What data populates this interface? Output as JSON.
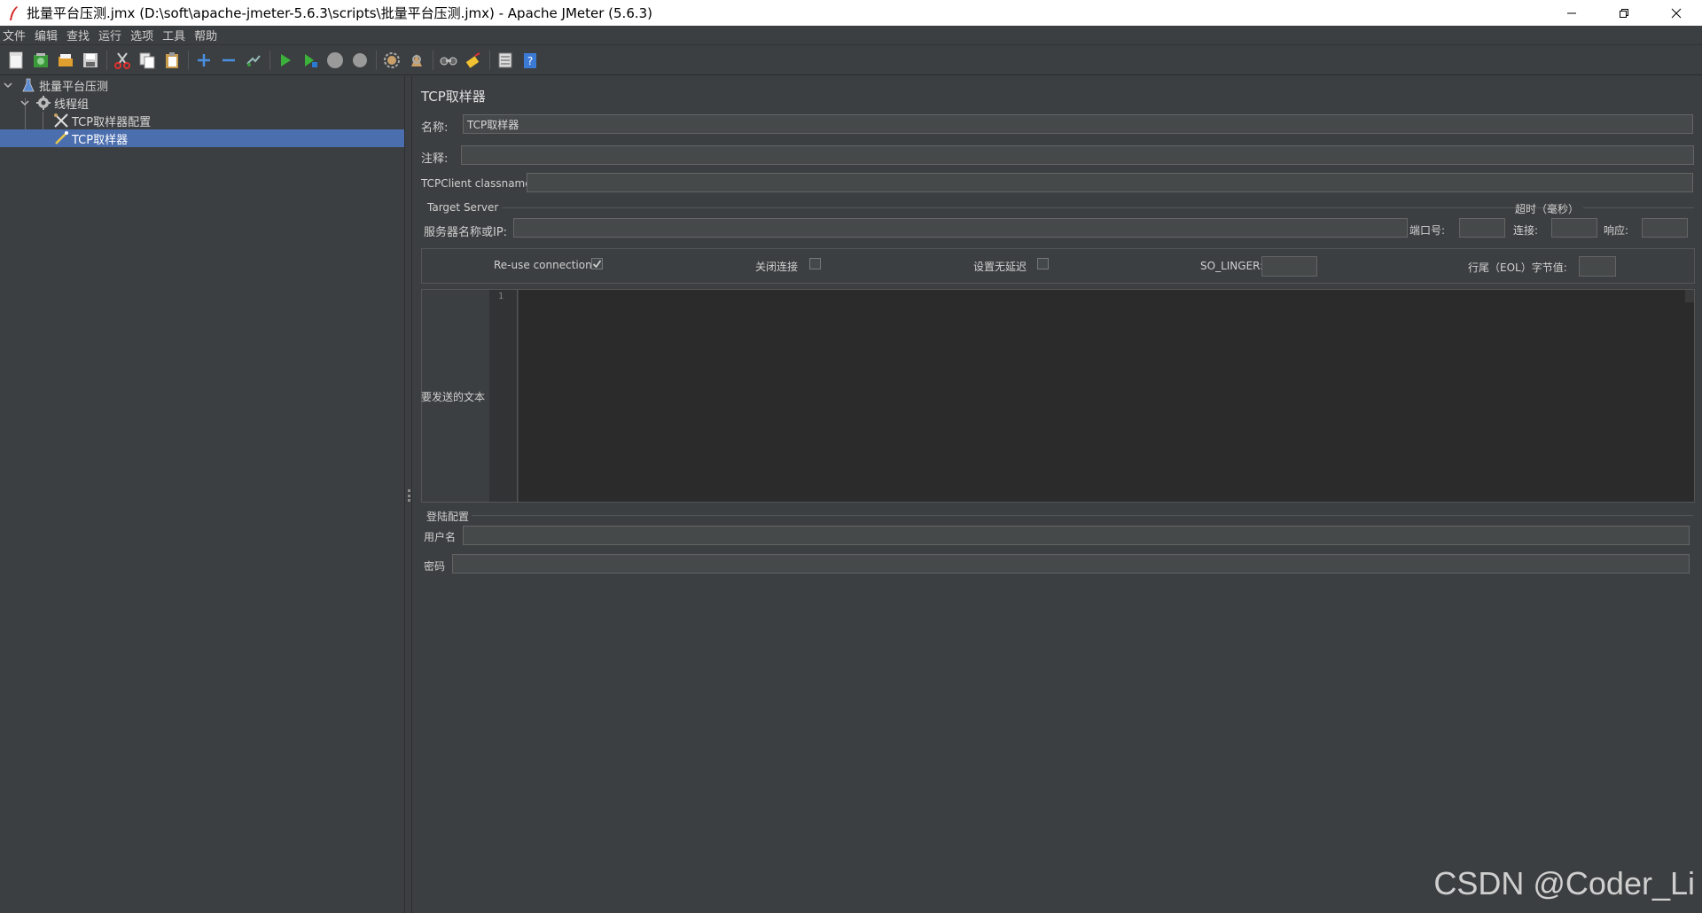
{
  "window": {
    "title": "批量平台压测.jmx (D:\\soft\\apache-jmeter-5.6.3\\scripts\\批量平台压测.jmx) - Apache JMeter (5.6.3)",
    "minimize_icon": "minimize-icon",
    "maximize_icon": "restore-icon",
    "close_icon": "close-icon"
  },
  "menu": [
    "文件",
    "编辑",
    "查找",
    "运行",
    "选项",
    "工具",
    "帮助"
  ],
  "toolbar": [
    "new-icon",
    "templates-icon",
    "open-icon",
    "save-icon",
    "cut-icon",
    "copy-icon",
    "paste-icon",
    "expand-icon",
    "collapse-icon",
    "toggle-icon",
    "start-icon",
    "start-no-pause-icon",
    "stop-icon",
    "shutdown-icon",
    "clear-icon",
    "clear-all-icon",
    "search-icon",
    "reset-search-icon",
    "function-helper-icon",
    "help-icon"
  ],
  "tree": {
    "items": [
      {
        "label": "批量平台压测",
        "icon": "test-plan-icon"
      },
      {
        "label": "线程组",
        "icon": "thread-group-icon"
      },
      {
        "label": "TCP取样器配置",
        "icon": "config-element-icon"
      },
      {
        "label": "TCP取样器",
        "icon": "sampler-icon",
        "selected": true
      }
    ]
  },
  "panel": {
    "title": "TCP取样器",
    "name_label": "名称:",
    "name_value": "TCP取样器",
    "comment_label": "注释:",
    "comment_value": "",
    "classname_label": "TCPClient classname:",
    "classname_value": "",
    "target_server_title": "Target Server",
    "server_label": "服务器名称或IP:",
    "server_value": "",
    "port_label": "端口号:",
    "port_value": "",
    "timeout_title": "超时（毫秒）",
    "connect_label": "连接:",
    "connect_value": "",
    "response_label": "响应:",
    "response_value": "",
    "reuse_label": "Re-use connection",
    "reuse_checked": true,
    "close_label": "关闭连接",
    "close_checked": false,
    "nodelay_label": "设置无延迟",
    "nodelay_checked": false,
    "so_linger_label": "SO_LINGER:",
    "so_linger_value": "",
    "eol_label": "行尾（EOL）字节值:",
    "eol_value": "",
    "text_to_send_label": "要发送的文本",
    "line_number": "1",
    "login_title": "登陆配置",
    "username_label": "用户名",
    "username_value": "",
    "password_label": "密码",
    "password_value": ""
  },
  "watermark": "CSDN @Coder_Li"
}
